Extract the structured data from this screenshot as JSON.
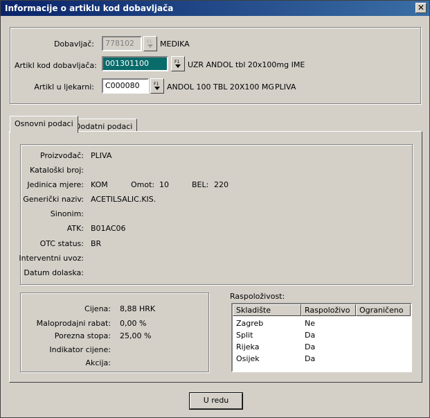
{
  "window": {
    "title": "Informacije o artiklu kod dobavljača",
    "close_glyph": "✕"
  },
  "header": {
    "supplier": {
      "label": "Dobavljač:",
      "code": "778102",
      "name": "MEDIKA"
    },
    "supplier_article": {
      "label": "Artikl kod dobavljača:",
      "code": "001301100",
      "name": "UZR ANDOL tbl 20x100mg IME"
    },
    "pharmacy_article": {
      "label": "Artikl u ljekarni:",
      "code": "C000080",
      "name": "ANDOL 100 TBL 20X100 MG",
      "manufacturer": "PLIVA"
    },
    "lookup_key": "F1"
  },
  "tabs": [
    {
      "label": "Osnovni podaci",
      "active": true
    },
    {
      "label": "Dodatni podaci",
      "active": false
    }
  ],
  "basic": {
    "manufacturer": {
      "label": "Proizvođač:",
      "value": "PLIVA"
    },
    "catalog_no": {
      "label": "Kataloški broj:",
      "value": ""
    },
    "unit": {
      "label": "Jedinica mjere:",
      "value": "KOM",
      "pack_label": "Omot:",
      "pack_value": "10",
      "bel_label": "BEL:",
      "bel_value": "220"
    },
    "generic_name": {
      "label": "Generički naziv:",
      "value": "ACETILSALIC.KIS."
    },
    "synonym": {
      "label": "Sinonim:",
      "value": ""
    },
    "atk": {
      "label": "ATK:",
      "value": "B01AC06"
    },
    "otc": {
      "label": "OTC status:",
      "value": "BR"
    },
    "interventional": {
      "label": "Interventni uvoz:",
      "value": ""
    },
    "arrival_date": {
      "label": "Datum dolaska:",
      "value": ""
    }
  },
  "pricing": {
    "price": {
      "label": "Cijena:",
      "value": "8,88 HRK"
    },
    "retail_discount": {
      "label": "Maloprodajni rabat:",
      "value": "0,00 %"
    },
    "tax_rate": {
      "label": "Porezna stopa:",
      "value": "25,00 %"
    },
    "price_indicator": {
      "label": "Indikator cijene:",
      "value": ""
    },
    "action": {
      "label": "Akcija:",
      "value": ""
    }
  },
  "availability": {
    "title": "Raspoloživost:",
    "columns": [
      "Skladište",
      "Raspoloživo",
      "Ograničeno"
    ],
    "rows": [
      [
        "Zagreb",
        "Ne",
        ""
      ],
      [
        "Split",
        "Da",
        ""
      ],
      [
        "Rijeka",
        "Da",
        ""
      ],
      [
        "Osijek",
        "Da",
        ""
      ]
    ]
  },
  "footer": {
    "ok_label": "U redu"
  }
}
